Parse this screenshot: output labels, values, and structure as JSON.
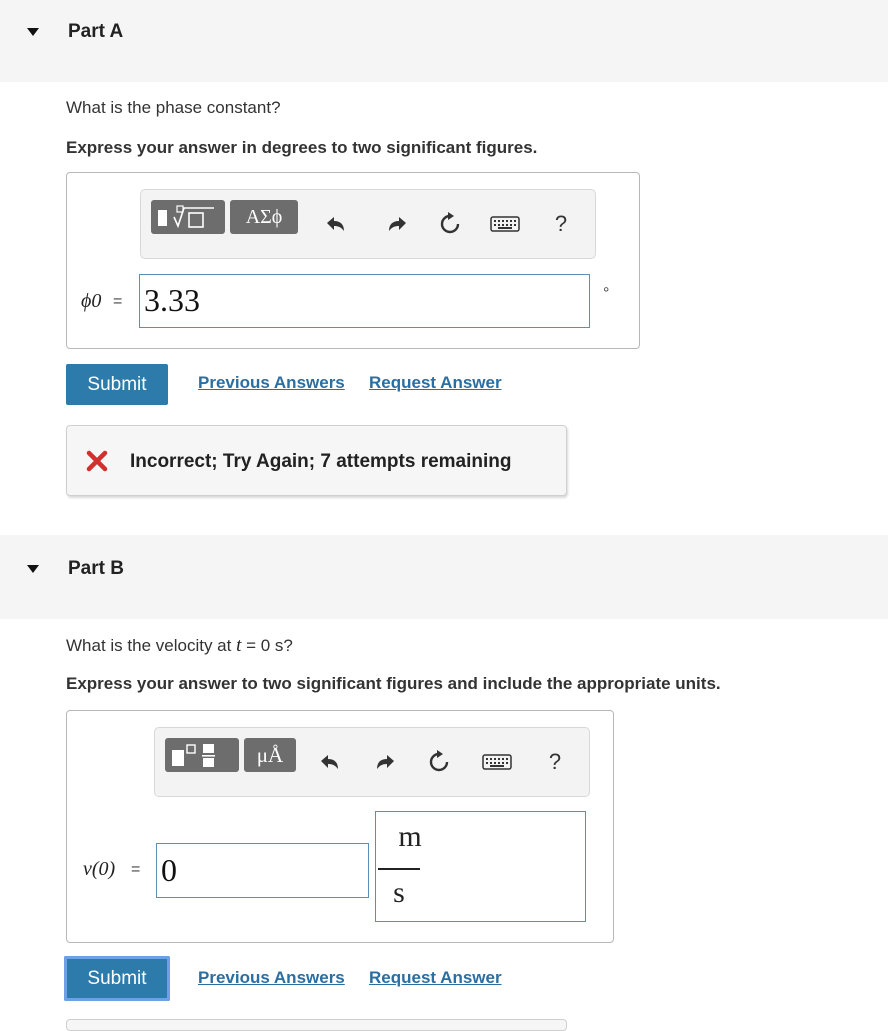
{
  "part_a": {
    "title": "Part A",
    "question": "What is the phase constant?",
    "instruction": "Express your answer in degrees to two significant figures.",
    "toolbar": {
      "greek_label": "ΑΣϕ",
      "help_label": "?"
    },
    "variable_label": "ϕ0",
    "equals": "=",
    "answer_value": "3.33",
    "unit_symbol": "°",
    "submit_label": "Submit",
    "previous_answers_label": "Previous Answers",
    "request_answer_label": "Request Answer",
    "feedback_text": "Incorrect; Try Again; 7 attempts remaining"
  },
  "part_b": {
    "title": "Part B",
    "question_prefix": "What is the velocity at ",
    "question_var": "t",
    "question_suffix": " = 0 s?",
    "instruction": "Express your answer to two significant figures and include the appropriate units.",
    "toolbar": {
      "units_label": "μÅ",
      "help_label": "?"
    },
    "variable_label": "v(0)",
    "equals": "=",
    "answer_value": "0",
    "unit_numerator": "m",
    "unit_denominator": "s",
    "submit_label": "Submit",
    "previous_answers_label": "Previous Answers",
    "request_answer_label": "Request Answer"
  },
  "colors": {
    "accent": "#2d7bab",
    "link": "#2a6ea2",
    "error": "#d32f2f",
    "header_bg": "#f5f5f5"
  }
}
